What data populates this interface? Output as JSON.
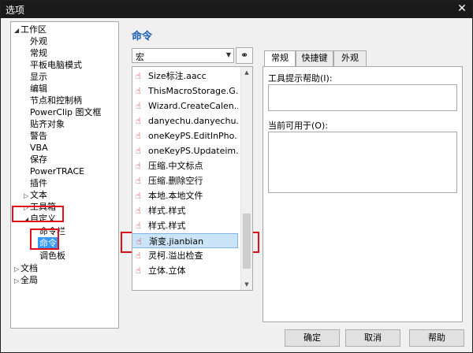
{
  "window": {
    "title": "选项",
    "close_glyph": "✕"
  },
  "tree": {
    "items": [
      {
        "label": "工作区",
        "expanded": true,
        "level": 0
      },
      {
        "label": "外观",
        "level": 1
      },
      {
        "label": "常规",
        "level": 1
      },
      {
        "label": "平板电脑模式",
        "level": 1
      },
      {
        "label": "显示",
        "level": 1
      },
      {
        "label": "编辑",
        "level": 1
      },
      {
        "label": "节点和控制柄",
        "level": 1
      },
      {
        "label": "PowerClip 图文框",
        "level": 1
      },
      {
        "label": "贴齐对象",
        "level": 1
      },
      {
        "label": "警告",
        "level": 1
      },
      {
        "label": "VBA",
        "level": 1
      },
      {
        "label": "保存",
        "level": 1
      },
      {
        "label": "PowerTRACE",
        "level": 1
      },
      {
        "label": "插件",
        "level": 1
      },
      {
        "label": "文本",
        "expanded": false,
        "level": 1
      },
      {
        "label": "工具箱",
        "expanded": false,
        "level": 1
      },
      {
        "label": "自定义",
        "expanded": true,
        "level": 1
      },
      {
        "label": "命令栏",
        "level": 2
      },
      {
        "label": "命令",
        "level": 2,
        "selected": true
      },
      {
        "label": "调色板",
        "level": 2
      },
      {
        "label": "文档",
        "expanded": false,
        "level": 0
      },
      {
        "label": "全局",
        "expanded": false,
        "level": 0
      }
    ]
  },
  "section_title": "命令",
  "category_dropdown": {
    "value": "宏"
  },
  "commands": [
    "Size标注.aacc",
    "ThisMacroStorage.G...",
    "Wizard.CreateCalen...",
    "danyechu.danyechu...",
    "oneKeyPS.EditInPho...",
    "oneKeyPS.Updateim...",
    "压缩.中文标点",
    "压缩.删除空行",
    "本地.本地文件",
    "样式.样式",
    "样式.样式",
    "渐变.jianbian",
    "灵柯.溢出检查",
    "立体.立体"
  ],
  "active_command_index": 11,
  "tabs": [
    {
      "label": "常规",
      "active": true
    },
    {
      "label": "快捷键",
      "active": false
    },
    {
      "label": "外观",
      "active": false
    }
  ],
  "general_tab": {
    "tooltip_help_label": "工具提示帮助(I):",
    "available_for_label": "当前可用于(O):"
  },
  "buttons": {
    "ok": "确定",
    "cancel": "取消",
    "help": "帮助"
  },
  "colors": {
    "highlight_red": "#e0101a",
    "accent_blue": "#1a5fb4",
    "selection": "#3399ff"
  }
}
